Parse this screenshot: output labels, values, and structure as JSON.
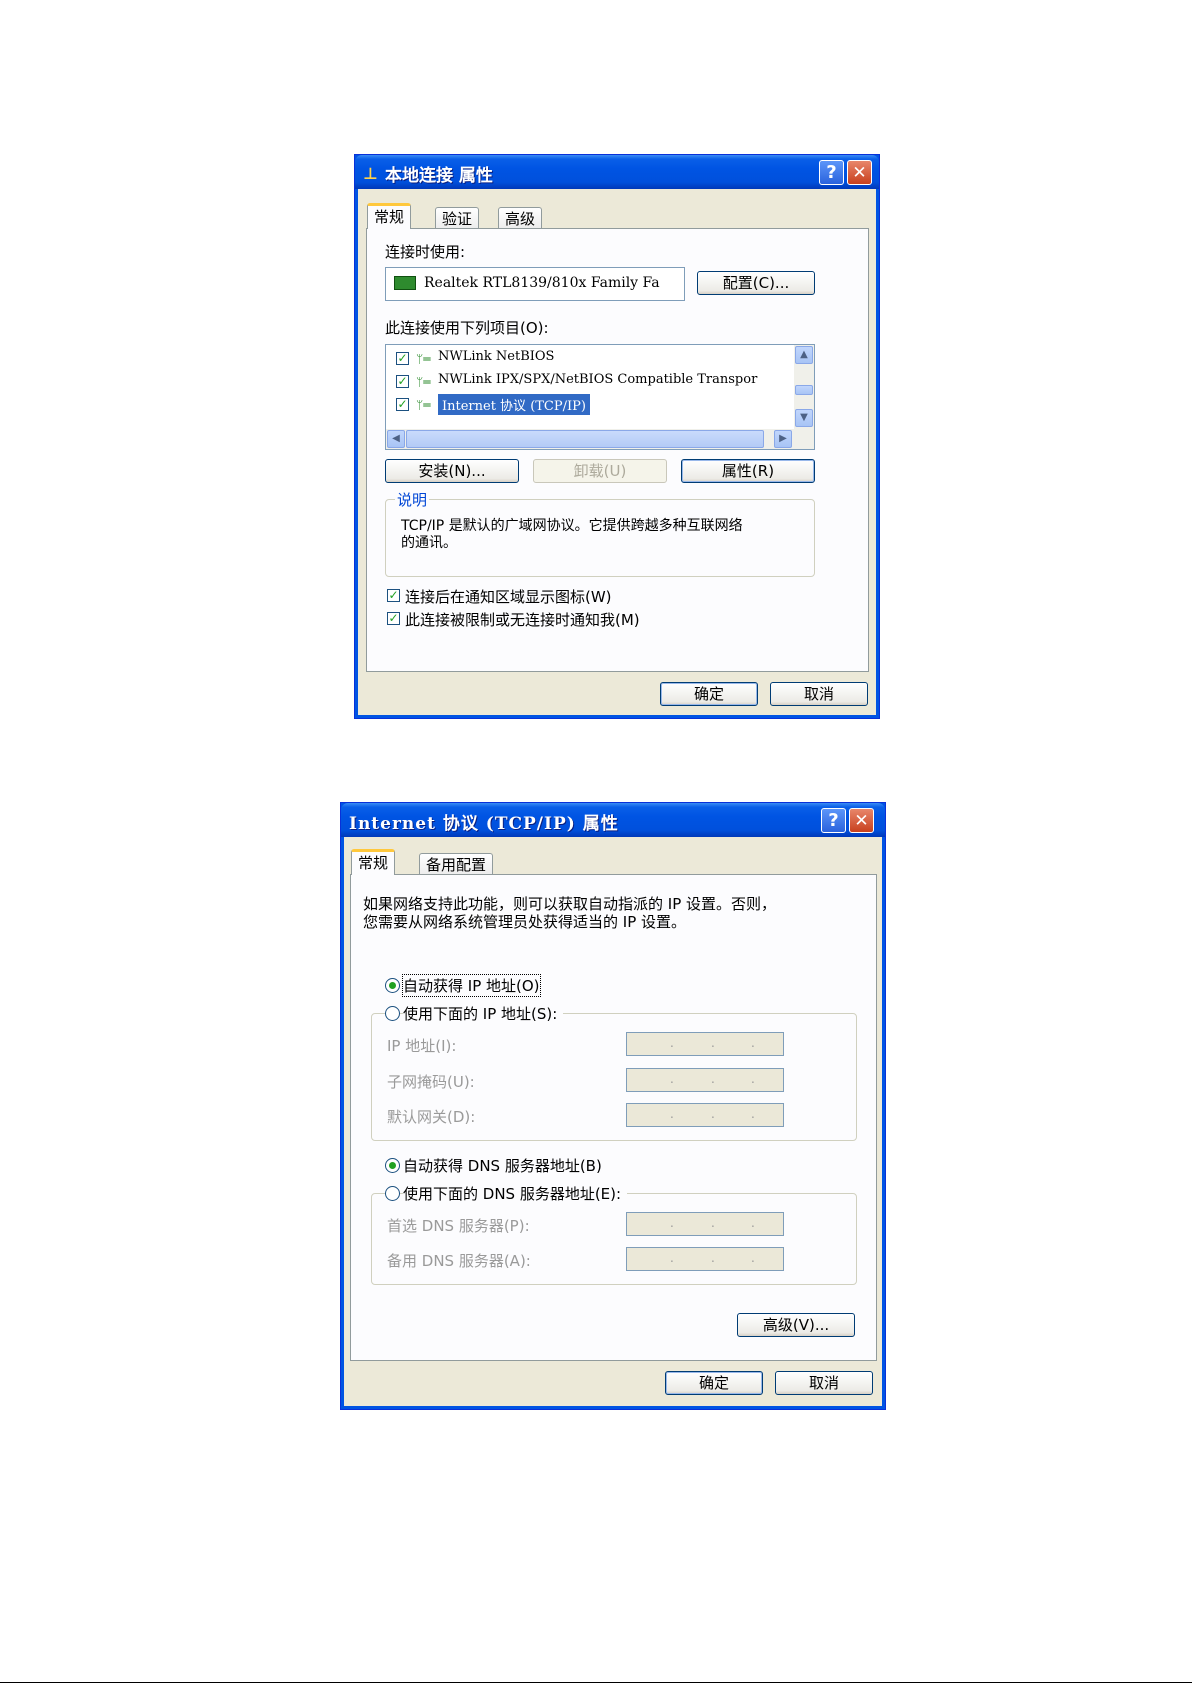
{
  "dialog1": {
    "title": "本地连接 属性",
    "help_glyph": "?",
    "close_glyph": "✕",
    "tabs": [
      "常规",
      "验证",
      "高级"
    ],
    "connect_using_label": "连接时使用:",
    "adapter_name": "Realtek RTL8139/810x Family Fa",
    "configure_button": "配置(C)...",
    "items_label": "此连接使用下列项目(O):",
    "items": [
      {
        "label": "NWLink NetBIOS",
        "checked": true,
        "selected": false
      },
      {
        "label": "NWLink IPX/SPX/NetBIOS Compatible Transpor",
        "checked": true,
        "selected": false
      },
      {
        "label": "Internet 协议 (TCP/IP)",
        "checked": true,
        "selected": true
      }
    ],
    "install_button": "安装(N)...",
    "uninstall_button": "卸载(U)",
    "properties_button": "属性(R)",
    "description_group_label": "说明",
    "description_text_line1": "TCP/IP 是默认的广域网协议。它提供跨越多种互联网络",
    "description_text_line2": "的通讯。",
    "show_icon_checkbox": "连接后在通知区域显示图标(W)",
    "notify_checkbox": "此连接被限制或无连接时通知我(M)",
    "ok_button": "确定",
    "cancel_button": "取消"
  },
  "dialog2": {
    "title": "Internet 协议 (TCP/IP) 属性",
    "help_glyph": "?",
    "close_glyph": "✕",
    "tabs": [
      "常规",
      "备用配置"
    ],
    "intro_line1": "如果网络支持此功能，则可以获取自动指派的 IP 设置。否则，",
    "intro_line2": "您需要从网络系统管理员处获得适当的 IP 设置。",
    "auto_ip_radio": "自动获得 IP 地址(O)",
    "manual_ip_radio": "使用下面的 IP 地址(S):",
    "ip_address_label": "IP 地址(I):",
    "subnet_label": "子网掩码(U):",
    "gateway_label": "默认网关(D):",
    "auto_dns_radio": "自动获得 DNS 服务器地址(B)",
    "manual_dns_radio": "使用下面的 DNS 服务器地址(E):",
    "preferred_dns_label": "首选 DNS 服务器(P):",
    "alternate_dns_label": "备用 DNS 服务器(A):",
    "ip_dot": ".",
    "advanced_button": "高级(V)...",
    "ok_button": "确定",
    "cancel_button": "取消"
  }
}
